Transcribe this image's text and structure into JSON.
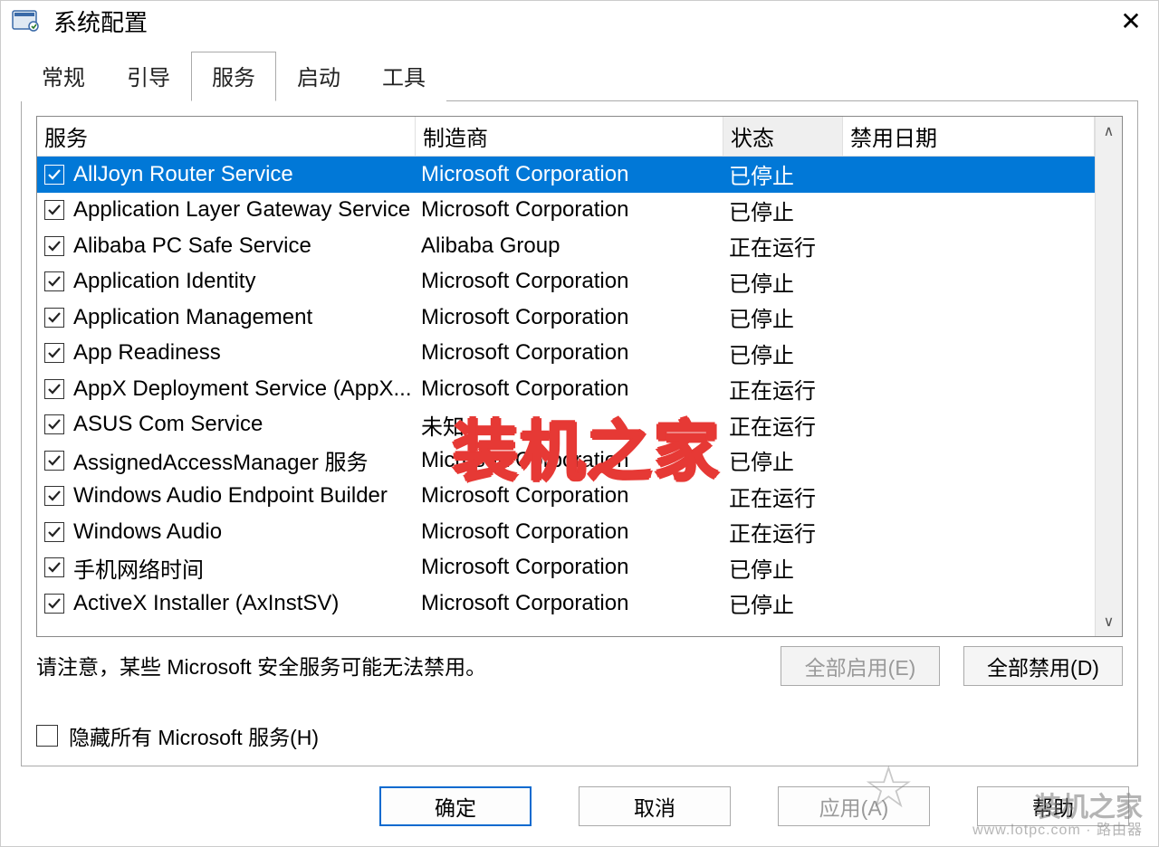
{
  "window": {
    "title": "系统配置"
  },
  "tabs": [
    {
      "label": "常规",
      "active": false
    },
    {
      "label": "引导",
      "active": false
    },
    {
      "label": "服务",
      "active": true
    },
    {
      "label": "启动",
      "active": false
    },
    {
      "label": "工具",
      "active": false
    }
  ],
  "columns": {
    "service": "服务",
    "manufacturer": "制造商",
    "status": "状态",
    "disabled_date": "禁用日期"
  },
  "services": [
    {
      "checked": true,
      "selected": true,
      "name": "AllJoyn Router Service",
      "manufacturer": "Microsoft Corporation",
      "status": "已停止",
      "disabled_date": ""
    },
    {
      "checked": true,
      "selected": false,
      "name": "Application Layer Gateway Service",
      "manufacturer": "Microsoft Corporation",
      "status": "已停止",
      "disabled_date": ""
    },
    {
      "checked": true,
      "selected": false,
      "name": "Alibaba PC Safe Service",
      "manufacturer": "Alibaba Group",
      "status": "正在运行",
      "disabled_date": ""
    },
    {
      "checked": true,
      "selected": false,
      "name": "Application Identity",
      "manufacturer": "Microsoft Corporation",
      "status": "已停止",
      "disabled_date": ""
    },
    {
      "checked": true,
      "selected": false,
      "name": "Application Management",
      "manufacturer": "Microsoft Corporation",
      "status": "已停止",
      "disabled_date": ""
    },
    {
      "checked": true,
      "selected": false,
      "name": "App Readiness",
      "manufacturer": "Microsoft Corporation",
      "status": "已停止",
      "disabled_date": ""
    },
    {
      "checked": true,
      "selected": false,
      "name": "AppX Deployment Service (AppX...",
      "manufacturer": "Microsoft Corporation",
      "status": "正在运行",
      "disabled_date": ""
    },
    {
      "checked": true,
      "selected": false,
      "name": "ASUS Com Service",
      "manufacturer": "未知",
      "status": "正在运行",
      "disabled_date": ""
    },
    {
      "checked": true,
      "selected": false,
      "name": "AssignedAccessManager 服务",
      "manufacturer": "Microsoft Corporation",
      "status": "已停止",
      "disabled_date": ""
    },
    {
      "checked": true,
      "selected": false,
      "name": "Windows Audio Endpoint Builder",
      "manufacturer": "Microsoft Corporation",
      "status": "正在运行",
      "disabled_date": ""
    },
    {
      "checked": true,
      "selected": false,
      "name": "Windows Audio",
      "manufacturer": "Microsoft Corporation",
      "status": "正在运行",
      "disabled_date": ""
    },
    {
      "checked": true,
      "selected": false,
      "name": "手机网络时间",
      "manufacturer": "Microsoft Corporation",
      "status": "已停止",
      "disabled_date": ""
    },
    {
      "checked": true,
      "selected": false,
      "name": "ActiveX Installer (AxInstSV)",
      "manufacturer": "Microsoft Corporation",
      "status": "已停止",
      "disabled_date": ""
    }
  ],
  "note_text": "请注意，某些 Microsoft 安全服务可能无法禁用。",
  "buttons": {
    "enable_all": "全部启用(E)",
    "disable_all": "全部禁用(D)",
    "hide_ms": "隐藏所有 Microsoft 服务(H)",
    "ok": "确定",
    "cancel": "取消",
    "apply": "应用(A)",
    "help": "帮助"
  },
  "watermarks": {
    "main": "装机之家",
    "corner_top": "装机之家",
    "corner_sub": "www.lotpc.com · 路由器"
  }
}
